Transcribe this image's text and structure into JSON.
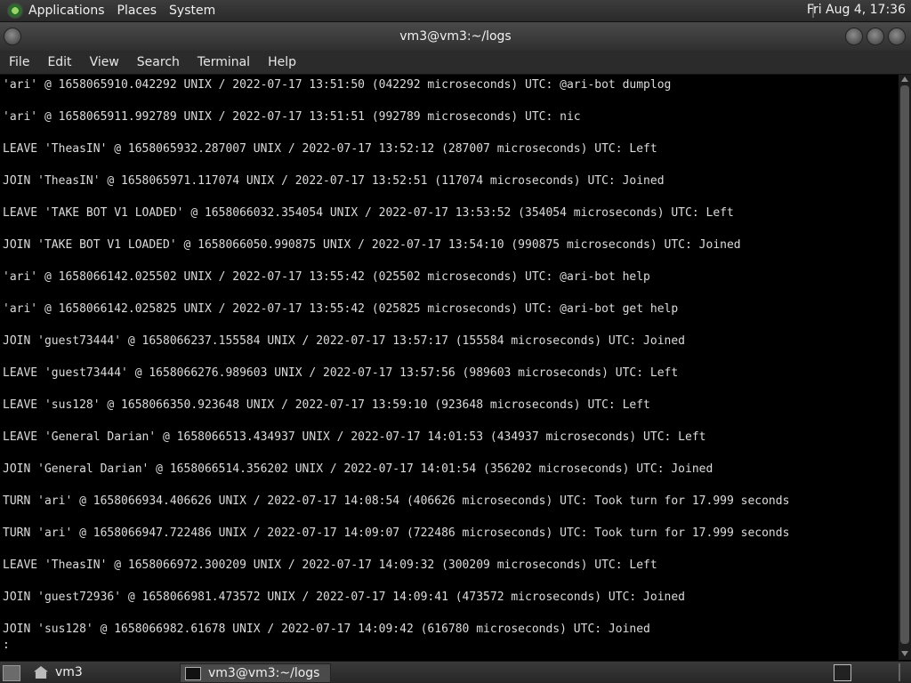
{
  "top_panel": {
    "menus": [
      "Applications",
      "Places",
      "System"
    ],
    "clock": "Fri Aug  4, 17:36"
  },
  "window": {
    "title": "vm3@vm3:~/logs"
  },
  "menubar": [
    "File",
    "Edit",
    "View",
    "Search",
    "Terminal",
    "Help"
  ],
  "terminal": {
    "lines": [
      "'ari' @ 1658065910.042292 UNIX / 2022-07-17 13:51:50 (042292 microseconds) UTC: @ari-bot dumplog",
      "",
      "'ari' @ 1658065911.992789 UNIX / 2022-07-17 13:51:51 (992789 microseconds) UTC: nic",
      "",
      "LEAVE 'TheasIN' @ 1658065932.287007 UNIX / 2022-07-17 13:52:12 (287007 microseconds) UTC: Left",
      "",
      "JOIN 'TheasIN' @ 1658065971.117074 UNIX / 2022-07-17 13:52:51 (117074 microseconds) UTC: Joined",
      "",
      "LEAVE 'TAKE BOT V1 LOADED' @ 1658066032.354054 UNIX / 2022-07-17 13:53:52 (354054 microseconds) UTC: Left",
      "",
      "JOIN 'TAKE BOT V1 LOADED' @ 1658066050.990875 UNIX / 2022-07-17 13:54:10 (990875 microseconds) UTC: Joined",
      "",
      "'ari' @ 1658066142.025502 UNIX / 2022-07-17 13:55:42 (025502 microseconds) UTC: @ari-bot help",
      "",
      "'ari' @ 1658066142.025825 UNIX / 2022-07-17 13:55:42 (025825 microseconds) UTC: @ari-bot get help",
      "",
      "JOIN 'guest73444' @ 1658066237.155584 UNIX / 2022-07-17 13:57:17 (155584 microseconds) UTC: Joined",
      "",
      "LEAVE 'guest73444' @ 1658066276.989603 UNIX / 2022-07-17 13:57:56 (989603 microseconds) UTC: Left",
      "",
      "LEAVE 'sus128' @ 1658066350.923648 UNIX / 2022-07-17 13:59:10 (923648 microseconds) UTC: Left",
      "",
      "LEAVE 'General Darian' @ 1658066513.434937 UNIX / 2022-07-17 14:01:53 (434937 microseconds) UTC: Left",
      "",
      "JOIN 'General Darian' @ 1658066514.356202 UNIX / 2022-07-17 14:01:54 (356202 microseconds) UTC: Joined",
      "",
      "TURN 'ari' @ 1658066934.406626 UNIX / 2022-07-17 14:08:54 (406626 microseconds) UTC: Took turn for 17.999 seconds",
      "",
      "TURN 'ari' @ 1658066947.722486 UNIX / 2022-07-17 14:09:07 (722486 microseconds) UTC: Took turn for 17.999 seconds",
      "",
      "LEAVE 'TheasIN' @ 1658066972.300209 UNIX / 2022-07-17 14:09:32 (300209 microseconds) UTC: Left",
      "",
      "JOIN 'guest72936' @ 1658066981.473572 UNIX / 2022-07-17 14:09:41 (473572 microseconds) UTC: Joined",
      "",
      "JOIN 'sus128' @ 1658066982.61678 UNIX / 2022-07-17 14:09:42 (616780 microseconds) UTC: Joined",
      ":"
    ]
  },
  "bottom_panel": {
    "home_label": "vm3",
    "task_label": "vm3@vm3:~/logs"
  },
  "icons": {
    "app_logo": "gnome-foot-icon",
    "home": "home-folder-icon",
    "terminal": "terminal-icon"
  }
}
